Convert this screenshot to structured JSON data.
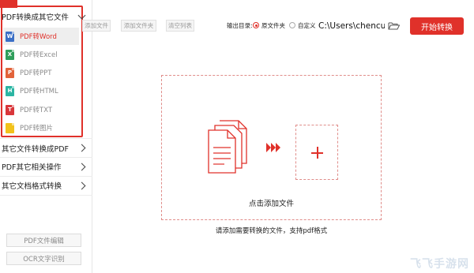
{
  "sidebar": {
    "groups": [
      {
        "label": "PDF转换成其它文件"
      },
      {
        "label": "其它文件转换成PDF"
      },
      {
        "label": "PDF其它相关操作"
      },
      {
        "label": "其它文档格式转换"
      }
    ],
    "items": [
      {
        "label": "PDF转Word",
        "icon_text": "W",
        "color": "#3b6fc6"
      },
      {
        "label": "PDF转Excel",
        "icon_text": "X",
        "color": "#2f9e5b"
      },
      {
        "label": "PDF转PPT",
        "icon_text": "P",
        "color": "#e2633a"
      },
      {
        "label": "PDF转HTML",
        "icon_text": "H",
        "color": "#2bb5a3"
      },
      {
        "label": "PDF转TXT",
        "icon_text": "T",
        "color": "#d9363a"
      },
      {
        "label": "PDF转图片",
        "icon_text": "",
        "color": "#f2c21b"
      }
    ],
    "tools": {
      "pdf_edit": "PDF文件编辑",
      "ocr": "OCR文字识别"
    }
  },
  "toolbar": {
    "add_file": "添加文件",
    "add_folder": "添加文件夹",
    "clear_list": "清空列表",
    "output_label": "输出目录:",
    "option_original": "原文件夹",
    "option_custom": "自定义",
    "output_path": "C:\\Users\\chencui",
    "start": "开始转换"
  },
  "main": {
    "drop_text": "点击添加文件",
    "hint": "请添加需要转换的文件，支持pdf格式"
  },
  "watermark": "飞飞手游网",
  "colors": {
    "accent": "#e0312a",
    "dashed": "#e08d8a"
  }
}
